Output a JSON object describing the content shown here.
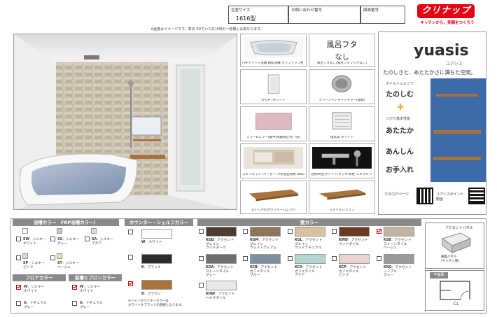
{
  "header": {
    "size_label": "浴室サイズ",
    "size_value": "1616型",
    "inquiry_label": "お問い合わせ番号",
    "drawing_label": "図面番号",
    "logo": "クリナップ",
    "tagline": "キッチンから、笑顔をつくろう",
    "note": "※画像はイメージです。表示 3Dでいただけ時の一結構とは異なります。"
  },
  "items": [
    {
      "caption": "FRPクリーン浴槽 親和浴槽 ポップアップ栓 /ハンドリップなし"
    },
    {
      "caption": "風呂フタなし(風呂フタフックなし)"
    },
    {
      "caption": "片引戸 /ホワイト"
    },
    {
      "caption": "クリーンヘアキャッチャー(鉄製)"
    },
    {
      "caption": "ミラー&ミラー(鏡中/飛散防止付) (浴)"
    },
    {
      "caption": "換気扇 ホワイト"
    },
    {
      "caption": "スタイル (スーパーセーフ付/浴室照明 ON/OFF) (有)"
    },
    {
      "caption": "浴用水栓(ホワイト/メッキ/水栓 ミネラル シャワー)"
    },
    {
      "caption": "1ハーフ付(カウンター (ロング)"
    },
    {
      "caption": "スタイルシェルフ"
    }
  ],
  "lid_panel": {
    "title": "風呂フタ",
    "value": "なし"
  },
  "ad": {
    "brand": "yuasis",
    "brand_kana": "ユアシス",
    "headline": "たのしさと、あたたかさに満ちた空間。",
    "points": [
      {
        "pre": "タイルシェルフで",
        "main": "たのしむ"
      },
      {
        "pre": "つかり基本性能",
        "main": "あたたか"
      },
      {
        "pre": "",
        "main": "あんしん"
      },
      {
        "pre": "",
        "main": "お手入れ"
      }
    ],
    "catalog_label": "カタログページ",
    "video_label": "ユアシスポイント動画"
  },
  "tub_colors": {
    "header": "浴槽カラー　FRP浴槽カラー）",
    "options": [
      {
        "code": "SW",
        "label": "シルキー\nホワイト",
        "color": "#f6f6f4",
        "checked": false
      },
      {
        "code": "SG",
        "label": "シルキー\nグレー",
        "color": "#c9c9c9",
        "checked": false
      },
      {
        "code": "SA",
        "label": "シルキー\nアクア",
        "color": "#cde7e8",
        "checked": false
      },
      {
        "code": "SP",
        "label": "シルキー\nピンク",
        "color": "#e8cdd6",
        "checked": false
      },
      {
        "code": "SY",
        "label": "シルキー\nベージュ",
        "color": "#ecdcae",
        "checked": false
      }
    ]
  },
  "floor_colors": {
    "header": "フロアカラー",
    "options": [
      {
        "code": "W",
        "label": "シルキー\nホワイト",
        "color": "#f4f4f4",
        "checked": true
      },
      {
        "code": "G",
        "label": "ナチュラル\nグレー",
        "color": "#d4d4d4",
        "checked": false
      }
    ]
  },
  "apron_colors": {
    "header": "浴槽エプロンカラー",
    "options": [
      {
        "code": "W",
        "label": "シルキー\nホワイト",
        "color": "#f4f4f4",
        "checked": true
      },
      {
        "code": "G",
        "label": "ナチュラル\nグレー",
        "color": "#d4d4d4",
        "checked": false
      }
    ]
  },
  "counter_colors": {
    "header": "カウンター・シェルフカラー",
    "options": [
      {
        "code": "W",
        "label": "ホワイト",
        "color": "#fbfbfb",
        "checked": false
      },
      {
        "code": "K",
        "label": "ブラック",
        "color": "#2b2b2b",
        "checked": false
      },
      {
        "code": "B",
        "label": "ブラウン",
        "color": "#a9733d",
        "checked": true
      }
    ],
    "note": "※シャンカウンターカラーは\nホワイトかブラックの選択となります。"
  },
  "wall_colors": {
    "header": "壁カラー",
    "options": [
      {
        "code": "KGD",
        "label": "アクセント\nグレイン\nウッドダーク",
        "color": "#4b3d31",
        "checked": false
      },
      {
        "code": "KGM",
        "label": "アクセント\nグレイン\nウッドミディアム",
        "color": "#8c7558",
        "checked": false
      },
      {
        "code": "KGL",
        "label": "アクセント\nグレイン\nウッドナチュラル",
        "color": "#d7c39b",
        "checked": false
      },
      {
        "code": "KWD",
        "label": "アクセント\nウッドダイル",
        "color": "#6a3a22",
        "checked": false
      },
      {
        "code": "KSB",
        "label": "アクセント\nストーンタイル\nベージュ",
        "color": "#bfb3a2",
        "checked": true
      },
      {
        "code": "KGA",
        "label": "アクセント\nストーンタイル\nグレー",
        "color": "#6e6e6e",
        "checked": false
      },
      {
        "code": "KCB",
        "label": "アクセント\nカフェタイル\nブルー",
        "color": "#7f8fa3",
        "checked": false
      },
      {
        "code": "KCA",
        "label": "アクセント\nカフェタイル\nアクア",
        "color": "#b4d6d2",
        "checked": false
      },
      {
        "code": "KCP",
        "label": "アクセント\nカフェタイル\nピンク",
        "color": "#e8d2d2",
        "checked": false
      },
      {
        "code": "KNG",
        "label": "アクセント\nノーブル\nグレー",
        "color": "#9a9a98",
        "checked": false
      },
      {
        "code": "KHW",
        "label": "アクセント\nヘキサタイル",
        "color": "#e9e9e9",
        "checked": false
      }
    ]
  },
  "accent_panel": {
    "title": "アクセントパネル",
    "caption": "横面パネル\n(キッチン側)"
  },
  "layout_panel": {
    "title": "平面図",
    "code": "CL"
  }
}
